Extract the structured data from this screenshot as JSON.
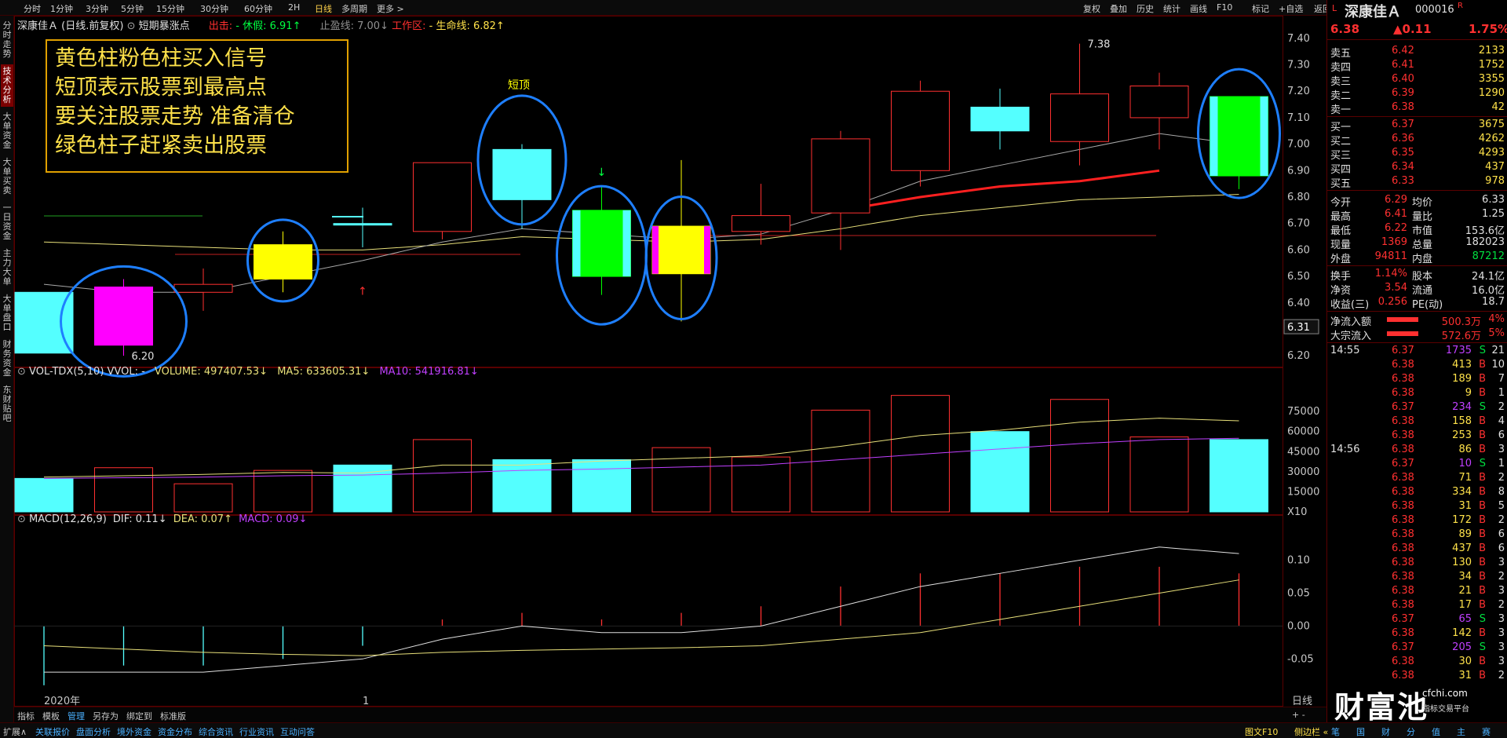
{
  "colors": {
    "bg": "#000000",
    "up_red": "#ff3030",
    "down_cyan": "#54ffff",
    "signal_yellow": "#ffff00",
    "signal_pink": "#ff00ff",
    "signal_green": "#00ff00",
    "circle_blue": "#1e7fff",
    "ma_yellow": "#e8e07a",
    "ma_purple": "#c040ff",
    "ma_white": "#dddddd",
    "price_red_line": "#ff2020"
  },
  "top_periods": [
    "分时",
    "1分钟",
    "3分钟",
    "5分钟",
    "15分钟",
    "30分钟",
    "60分钟",
    "2H",
    "日线",
    "多周期",
    "更多 >"
  ],
  "top_active": "日线",
  "top_tools": [
    "复权",
    "叠加",
    "历史",
    "统计",
    "画线",
    "F10",
    "标记",
    "+自选",
    "返回"
  ],
  "left_tabs": [
    "分时走势",
    "技术分析",
    "大单资金",
    "大单买卖",
    "一日资金",
    "主力大单",
    "大单盘口",
    "财务资金",
    "东财贴吧"
  ],
  "left_active": "技术分析",
  "header": {
    "stock": "深康佳Ａ (日线.前复权)",
    "indicator": "短期暴涨点",
    "chu_label": "出击:",
    "chu_value": "- 休假: 6.91↑",
    "zhiying": "止盈线: 7.00↓",
    "gongzuo": "工作区:",
    "shengming": "- 生命线: 6.82↑"
  },
  "annotation": {
    "lines": [
      "黄色柱粉色柱买入信号",
      "短顶表示股票到最高点",
      "要关注股票走势  准备清仓",
      "绿色柱子赶紧卖出股票"
    ]
  },
  "price_labels": {
    "short_top": "短顶",
    "high": "7.38",
    "low": "6.20",
    "current": "6.31"
  },
  "price_axis": [
    "7.40",
    "7.30",
    "7.20",
    "7.10",
    "7.00",
    "6.90",
    "6.80",
    "6.70",
    "6.60",
    "6.50",
    "6.40",
    "6.30",
    "6.20"
  ],
  "vol_header": {
    "name": "VOL-TDX(5,10) VVOL: -",
    "volume": "VOLUME: 497407.53↓",
    "ma5": "MA5: 633605.31↓",
    "ma10": "MA10: 541916.81↓"
  },
  "vol_axis": [
    "75000",
    "60000",
    "45000",
    "30000",
    "15000",
    "X10"
  ],
  "macd_header": {
    "name": "MACD(12,26,9)",
    "dif": "DIF: 0.11↓",
    "dea": "DEA: 0.07↑",
    "macd": "MACD: 0.09↓"
  },
  "macd_axis": [
    "0.10",
    "0.05",
    "0.00",
    "-0.05"
  ],
  "x_labels": {
    "year": "2020年",
    "month": "1"
  },
  "chart_corner": "日线",
  "chart_corner_sub": "+ -",
  "bottom_tabs_left": [
    "指标",
    "模板",
    "管理",
    "另存为",
    "绑定到",
    "标准版"
  ],
  "chart_data": {
    "type": "candlestick",
    "ohlc": [
      {
        "o": 6.44,
        "h": 6.44,
        "l": 6.21,
        "c": 6.21,
        "color": "cyan"
      },
      {
        "o": 6.24,
        "h": 6.49,
        "l": 6.2,
        "c": 6.46,
        "color": "pink"
      },
      {
        "o": 6.47,
        "h": 6.53,
        "l": 6.37,
        "c": 6.44,
        "color": "red"
      },
      {
        "o": 6.49,
        "h": 6.67,
        "l": 6.44,
        "c": 6.62,
        "color": "yellow"
      },
      {
        "o": 6.7,
        "h": 6.76,
        "l": 6.61,
        "c": 6.7,
        "color": "cyan"
      },
      {
        "o": 6.67,
        "h": 6.92,
        "l": 6.64,
        "c": 6.93,
        "color": "red"
      },
      {
        "o": 6.98,
        "h": 7.0,
        "l": 6.68,
        "c": 6.79,
        "color": "cyan"
      },
      {
        "o": 6.75,
        "h": 6.84,
        "l": 6.43,
        "c": 6.5,
        "color": "green"
      },
      {
        "o": 6.51,
        "h": 6.94,
        "l": 6.33,
        "c": 6.69,
        "color": "yellow"
      },
      {
        "o": 6.67,
        "h": 6.85,
        "l": 6.62,
        "c": 6.73,
        "color": "red"
      },
      {
        "o": 6.74,
        "h": 7.05,
        "l": 6.6,
        "c": 7.02,
        "color": "red"
      },
      {
        "o": 6.9,
        "h": 7.24,
        "l": 6.84,
        "c": 7.2,
        "color": "red"
      },
      {
        "o": 7.14,
        "h": 7.21,
        "l": 6.98,
        "c": 7.05,
        "color": "cyan"
      },
      {
        "o": 7.01,
        "h": 7.38,
        "l": 6.92,
        "c": 7.19,
        "color": "red"
      },
      {
        "o": 7.1,
        "h": 7.27,
        "l": 6.98,
        "c": 7.22,
        "color": "red"
      },
      {
        "o": 7.18,
        "h": 7.18,
        "l": 6.83,
        "c": 6.88,
        "color": "green"
      }
    ],
    "volume": [
      25000,
      33000,
      21000,
      31000,
      35000,
      54000,
      39000,
      39000,
      48000,
      41000,
      76000,
      87000,
      60000,
      84000,
      56000,
      54000
    ],
    "volume_colors": [
      "cyan",
      "red",
      "red",
      "red",
      "cyan",
      "red",
      "cyan",
      "cyan",
      "red",
      "red",
      "red",
      "red",
      "cyan",
      "red",
      "red",
      "cyan"
    ],
    "vol_ma5": [
      26000,
      27000,
      28000,
      29500,
      29000,
      35000,
      35000,
      38000,
      40000,
      42000,
      49000,
      57000,
      61000,
      67000,
      70000,
      68000
    ],
    "vol_ma10": [
      25000,
      25500,
      26000,
      27000,
      27500,
      29000,
      31000,
      32000,
      33500,
      35000,
      39000,
      43000,
      47000,
      51000,
      54000,
      55000
    ],
    "macd_hist": [
      -0.09,
      -0.06,
      -0.06,
      -0.05,
      -0.03,
      0.01,
      0.02,
      0.01,
      0.02,
      0.03,
      0.06,
      0.08,
      0.08,
      0.09,
      0.09,
      0.08
    ],
    "dif": [
      -0.07,
      -0.07,
      -0.07,
      -0.06,
      -0.05,
      -0.02,
      0.0,
      -0.01,
      -0.01,
      0.0,
      0.03,
      0.06,
      0.08,
      0.1,
      0.12,
      0.11
    ],
    "dea": [
      -0.03,
      -0.035,
      -0.04,
      -0.043,
      -0.045,
      -0.04,
      -0.037,
      -0.035,
      -0.033,
      -0.03,
      -0.02,
      -0.01,
      0.01,
      0.03,
      0.05,
      0.07
    ],
    "ma_white": [
      6.47,
      6.44,
      6.44,
      6.5,
      6.56,
      6.63,
      6.68,
      6.66,
      6.64,
      6.66,
      6.75,
      6.86,
      6.92,
      6.98,
      7.04,
      7.0
    ],
    "ma_yellow": [
      6.63,
      6.62,
      6.61,
      6.6,
      6.6,
      6.62,
      6.65,
      6.64,
      6.63,
      6.64,
      6.68,
      6.73,
      6.76,
      6.79,
      6.8,
      6.81
    ],
    "red_line": {
      "from_index": 10,
      "values": [
        6.75,
        6.8,
        6.84,
        6.86,
        6.9
      ]
    },
    "ylim_price": [
      6.15,
      7.45
    ],
    "ylim_vol": [
      0,
      95000
    ],
    "ylim_macd": [
      -0.12,
      0.14
    ]
  },
  "right_panel": {
    "title": "深康佳Ａ",
    "code": "000016",
    "mark_l": "L",
    "mark_r": "R",
    "price": "6.38",
    "change": "▲0.11",
    "pct": "1.75%",
    "sells": [
      {
        "label": "卖五",
        "price": "6.42",
        "vol": "2133"
      },
      {
        "label": "卖四",
        "price": "6.41",
        "vol": "1752"
      },
      {
        "label": "卖三",
        "price": "6.40",
        "vol": "3355"
      },
      {
        "label": "卖二",
        "price": "6.39",
        "vol": "1290"
      },
      {
        "label": "卖一",
        "price": "6.38",
        "vol": "42"
      }
    ],
    "buys": [
      {
        "label": "买一",
        "price": "6.37",
        "vol": "3675"
      },
      {
        "label": "买二",
        "price": "6.36",
        "vol": "4262"
      },
      {
        "label": "买三",
        "price": "6.35",
        "vol": "4293"
      },
      {
        "label": "买四",
        "price": "6.34",
        "vol": "437"
      },
      {
        "label": "买五",
        "price": "6.33",
        "vol": "978"
      }
    ],
    "stats": [
      {
        "l1": "今开",
        "v1": "6.29",
        "l2": "均价",
        "v2": "6.33"
      },
      {
        "l1": "最高",
        "v1": "6.41",
        "l2": "量比",
        "v2": "1.25"
      },
      {
        "l1": "最低",
        "v1": "6.22",
        "l2": "市值",
        "v2": "153.6亿"
      },
      {
        "l1": "现量",
        "v1": "1369",
        "l2": "总量",
        "v2": "182023"
      },
      {
        "l1": "外盘",
        "v1": "94811",
        "l2": "内盘",
        "v2": "87212"
      }
    ],
    "stats2": [
      {
        "l1": "换手",
        "v1": "1.14%",
        "l2": "股本",
        "v2": "24.1亿"
      },
      {
        "l1": "净资",
        "v1": "3.54",
        "l2": "流通",
        "v2": "16.0亿"
      },
      {
        "l1": "收益(三)",
        "v1": "0.256",
        "l2": "PE(动)",
        "v2": "18.7"
      }
    ],
    "flows": [
      {
        "label": "净流入额",
        "value": "500.3万",
        "pct": "4%",
        "fill": 0.8
      },
      {
        "label": "大宗流入",
        "value": "572.6万",
        "pct": "5%",
        "fill": 0.8
      }
    ],
    "ticks": [
      {
        "time": "14:55",
        "price": "6.37",
        "vol": "1735",
        "bs": "S",
        "n": "21"
      },
      {
        "time": "",
        "price": "6.38",
        "vol": "413",
        "bs": "B",
        "n": "10"
      },
      {
        "time": "",
        "price": "6.38",
        "vol": "189",
        "bs": "B",
        "n": "7"
      },
      {
        "time": "",
        "price": "6.38",
        "vol": "9",
        "bs": "B",
        "n": "1"
      },
      {
        "time": "",
        "price": "6.37",
        "vol": "234",
        "bs": "S",
        "n": "2"
      },
      {
        "time": "",
        "price": "6.38",
        "vol": "158",
        "bs": "B",
        "n": "4"
      },
      {
        "time": "",
        "price": "6.38",
        "vol": "253",
        "bs": "B",
        "n": "6"
      },
      {
        "time": "14:56",
        "price": "6.38",
        "vol": "86",
        "bs": "B",
        "n": "3"
      },
      {
        "time": "",
        "price": "6.37",
        "vol": "10",
        "bs": "S",
        "n": "1"
      },
      {
        "time": "",
        "price": "6.38",
        "vol": "71",
        "bs": "B",
        "n": "2"
      },
      {
        "time": "",
        "price": "6.38",
        "vol": "334",
        "bs": "B",
        "n": "8"
      },
      {
        "time": "",
        "price": "6.38",
        "vol": "31",
        "bs": "B",
        "n": "5"
      },
      {
        "time": "",
        "price": "6.38",
        "vol": "172",
        "bs": "B",
        "n": "2"
      },
      {
        "time": "",
        "price": "6.38",
        "vol": "89",
        "bs": "B",
        "n": "6"
      },
      {
        "time": "",
        "price": "6.38",
        "vol": "437",
        "bs": "B",
        "n": "6"
      },
      {
        "time": "",
        "price": "6.38",
        "vol": "130",
        "bs": "B",
        "n": "3"
      },
      {
        "time": "",
        "price": "6.38",
        "vol": "34",
        "bs": "B",
        "n": "2"
      },
      {
        "time": "",
        "price": "6.38",
        "vol": "21",
        "bs": "B",
        "n": "3"
      },
      {
        "time": "",
        "price": "6.38",
        "vol": "17",
        "bs": "B",
        "n": "2"
      },
      {
        "time": "",
        "price": "6.37",
        "vol": "65",
        "bs": "S",
        "n": "3"
      },
      {
        "time": "",
        "price": "6.38",
        "vol": "142",
        "bs": "B",
        "n": "3"
      },
      {
        "time": "",
        "price": "6.37",
        "vol": "205",
        "bs": "S",
        "n": "3"
      },
      {
        "time": "",
        "price": "6.38",
        "vol": "30",
        "bs": "B",
        "n": "3"
      },
      {
        "time": "",
        "price": "6.38",
        "vol": "31",
        "bs": "B",
        "n": "2"
      }
    ]
  },
  "bottom_left": [
    "扩展∧",
    "关联报价",
    "盘面分析",
    "境外资金",
    "资金分布",
    "综合资讯",
    "行业资讯",
    "互动问答"
  ],
  "bottom_right": [
    "图文F10",
    "侧边栏 «"
  ],
  "bottom_right_icons": [
    "笔",
    "国",
    "财",
    "分",
    "值",
    "主",
    "赛"
  ],
  "watermark": {
    "brand": "财富池",
    "site": "cfchi.com",
    "sub": "指标交易平台"
  }
}
